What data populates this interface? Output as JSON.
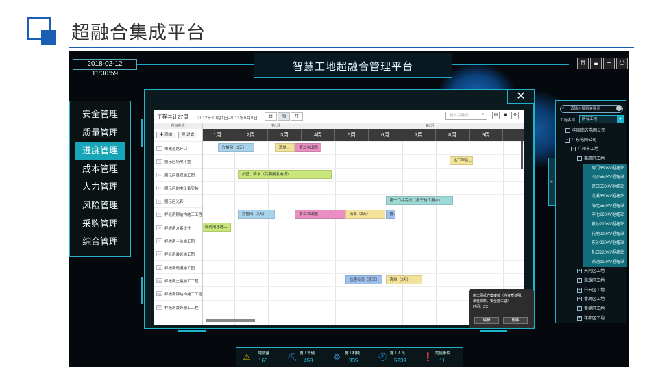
{
  "slide": {
    "title": "超融合集成平台"
  },
  "app": {
    "datetime": "2018-02-12   11:30:59",
    "title": "智慧工地超融合管理平台",
    "nav": [
      "安全管理",
      "质量管理",
      "进度管理",
      "成本管理",
      "人力管理",
      "风险管理",
      "采购管理",
      "综合管理"
    ],
    "nav_active": 2
  },
  "gantt": {
    "title": "工程共计27周",
    "range": "2012年10月1日-2013年6月8日",
    "view_buttons": [
      "日",
      "周",
      "月"
    ],
    "search_placeholder": "输入关键词",
    "name_header": "项目名称",
    "add_label": "添加",
    "filter_label": "过滤",
    "months": [
      "第1月",
      "第2月"
    ],
    "weeks": [
      "1周",
      "2周",
      "3周",
      "4周",
      "5周",
      "6周",
      "7周",
      "8周",
      "9周"
    ],
    "rows": [
      {
        "num": "01",
        "name": "市政道路开口"
      },
      {
        "num": "02",
        "name": "展示区场地平整"
      },
      {
        "num": "03",
        "name": "展示区景观施工图"
      },
      {
        "num": "04",
        "name": "展示区的电设备安装"
      },
      {
        "num": "04",
        "name": "展示区光彩"
      },
      {
        "num": "05",
        "name": "样板房钢结构施工工程"
      },
      {
        "num": "06",
        "name": "样板房方案设计"
      },
      {
        "num": "07",
        "name": "样板房主体施工图"
      },
      {
        "num": "08",
        "name": "样板房装饰施工图"
      },
      {
        "num": "09",
        "name": "样板房暖通施工图"
      },
      {
        "num": "010",
        "name": "样板房土建施工工程"
      },
      {
        "num": "011",
        "name": "样板房钢结构施工工程"
      },
      {
        "num": "012",
        "name": "样板房装饰施工工程"
      }
    ],
    "bars": [
      {
        "row": 0,
        "start": 0.5,
        "len": 1.1,
        "color": "blue",
        "text": "方格网（3天）"
      },
      {
        "row": 0,
        "start": 2.2,
        "len": 0.6,
        "color": "yellow",
        "text": "清单..."
      },
      {
        "row": 0,
        "start": 2.8,
        "len": 0.8,
        "color": "pink",
        "text": "第二次出图"
      },
      {
        "row": 1,
        "start": 7.4,
        "len": 0.7,
        "color": "yellow",
        "text": "场下室及..."
      },
      {
        "row": 2,
        "start": 1.1,
        "len": 2.8,
        "color": "green",
        "text": "护壁、降水（后期用发电机）"
      },
      {
        "row": 4,
        "start": 5.5,
        "len": 2.0,
        "color": "teal",
        "text": "第一口井完成（用于施工用水）"
      },
      {
        "row": 5,
        "start": 1.1,
        "len": 1.1,
        "color": "blue",
        "text": "方格网（3天）"
      },
      {
        "row": 5,
        "start": 2.8,
        "len": 1.5,
        "color": "pink",
        "text": "第二次出图"
      },
      {
        "row": 5,
        "start": 4.3,
        "len": 1.2,
        "color": "yellow",
        "text": "清单（3天）"
      },
      {
        "row": 5,
        "start": 5.5,
        "len": 0.3,
        "color": "lblue",
        "text": "施工..."
      },
      {
        "row": 6,
        "start": 0.0,
        "len": 0.9,
        "color": "green",
        "text": "临时用水施工"
      },
      {
        "row": 10,
        "start": 4.3,
        "len": 1.1,
        "color": "lblue",
        "text": "监理合同（集采）"
      },
      {
        "row": 10,
        "start": 5.5,
        "len": 1.1,
        "color": "yellow",
        "text": "清单（3天）"
      }
    ],
    "popup": {
      "line1": "施工图纸方案审核（含资质证明、",
      "line2": "年检资料、安全施工证）",
      "line3": "时间：3天",
      "edit": "编辑",
      "delete": "删除"
    }
  },
  "tree": {
    "search_placeholder": "请输入搜索关键词",
    "site_label": "工地名称：",
    "site_value": "所有工地",
    "nodes": [
      {
        "level": 0,
        "text": "中国南方电网公司",
        "toggle": "-"
      },
      {
        "level": 1,
        "text": "广东电网公司",
        "toggle": "-"
      },
      {
        "level": 2,
        "text": "广州市工地",
        "toggle": "-"
      },
      {
        "level": 3,
        "text": "荔湾区工地",
        "toggle": "-"
      },
      {
        "level": 4,
        "text": "周门550KV枢纽站"
      },
      {
        "level": 4,
        "text": "河沙550KV枢纽站"
      },
      {
        "level": 4,
        "text": "蓬口550KV枢纽站"
      },
      {
        "level": 4,
        "text": "龙溪550KV枢纽站"
      },
      {
        "level": 4,
        "text": "海北550KV枢纽站"
      },
      {
        "level": 4,
        "text": "中七220KV枢纽站"
      },
      {
        "level": 4,
        "text": "黄沙220KV枢纽站"
      },
      {
        "level": 4,
        "text": "花地220KV枢纽站"
      },
      {
        "level": 4,
        "text": "东沙220KV枢纽站"
      },
      {
        "level": 4,
        "text": "轧口220KV枢纽站"
      },
      {
        "level": 4,
        "text": "茶滘110KV枢纽站"
      },
      {
        "level": 3,
        "text": "天河区工地",
        "toggle": "+"
      },
      {
        "level": 3,
        "text": "海珠区工地",
        "toggle": "+"
      },
      {
        "level": 3,
        "text": "白云区工地",
        "toggle": "+"
      },
      {
        "level": 3,
        "text": "番禺区工地",
        "toggle": "+"
      },
      {
        "level": 3,
        "text": "黄埔区工地",
        "toggle": "+"
      },
      {
        "level": 3,
        "text": "花都区工地",
        "toggle": "+"
      }
    ]
  },
  "stats": [
    {
      "label": "工地数量",
      "value": "160",
      "icon": "warning-icon"
    },
    {
      "label": "施工车辆",
      "value": "458",
      "icon": "excavator-icon"
    },
    {
      "label": "施工机械",
      "value": "335",
      "icon": "machine-icon"
    },
    {
      "label": "施工人员",
      "value": "5239",
      "icon": "worker-icon"
    },
    {
      "label": "危险事件",
      "value": "11",
      "icon": "alert-icon"
    }
  ],
  "colors": {
    "accent": "#1eb3c9",
    "brand": "#1a5fb4",
    "active_nav": "#19a5b8",
    "value": "#29c6e0"
  }
}
